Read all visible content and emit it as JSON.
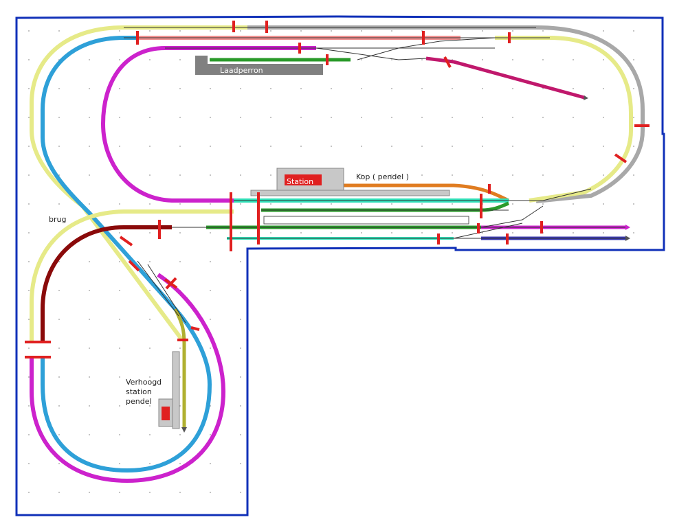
{
  "labels": {
    "laadperron": "Laadperron",
    "station": "Station",
    "kop_pendel": "Kop ( pendel )",
    "brug": "brug",
    "verhoogd_1": "Verhoogd",
    "verhoogd_2": "station",
    "verhoogd_3": "pendel"
  },
  "colors": {
    "border": "#1030b8",
    "grid_dot": "#9a9a9a",
    "rail": "#333333",
    "blue": "#2ea0d8",
    "yellow": "#e6ea88",
    "gray": "#a8a8a8",
    "pink": "#f09090",
    "magenta": "#cc22cc",
    "green": "#2a9a2a",
    "crimson": "#c0186c",
    "orange": "#e07c20",
    "cyan": "#30e0b8",
    "darkred": "#8a0a0a",
    "olive": "#b0b030",
    "navy": "#3a3ab0",
    "platform": "#c8c8c8",
    "isolator": "#e02020"
  }
}
